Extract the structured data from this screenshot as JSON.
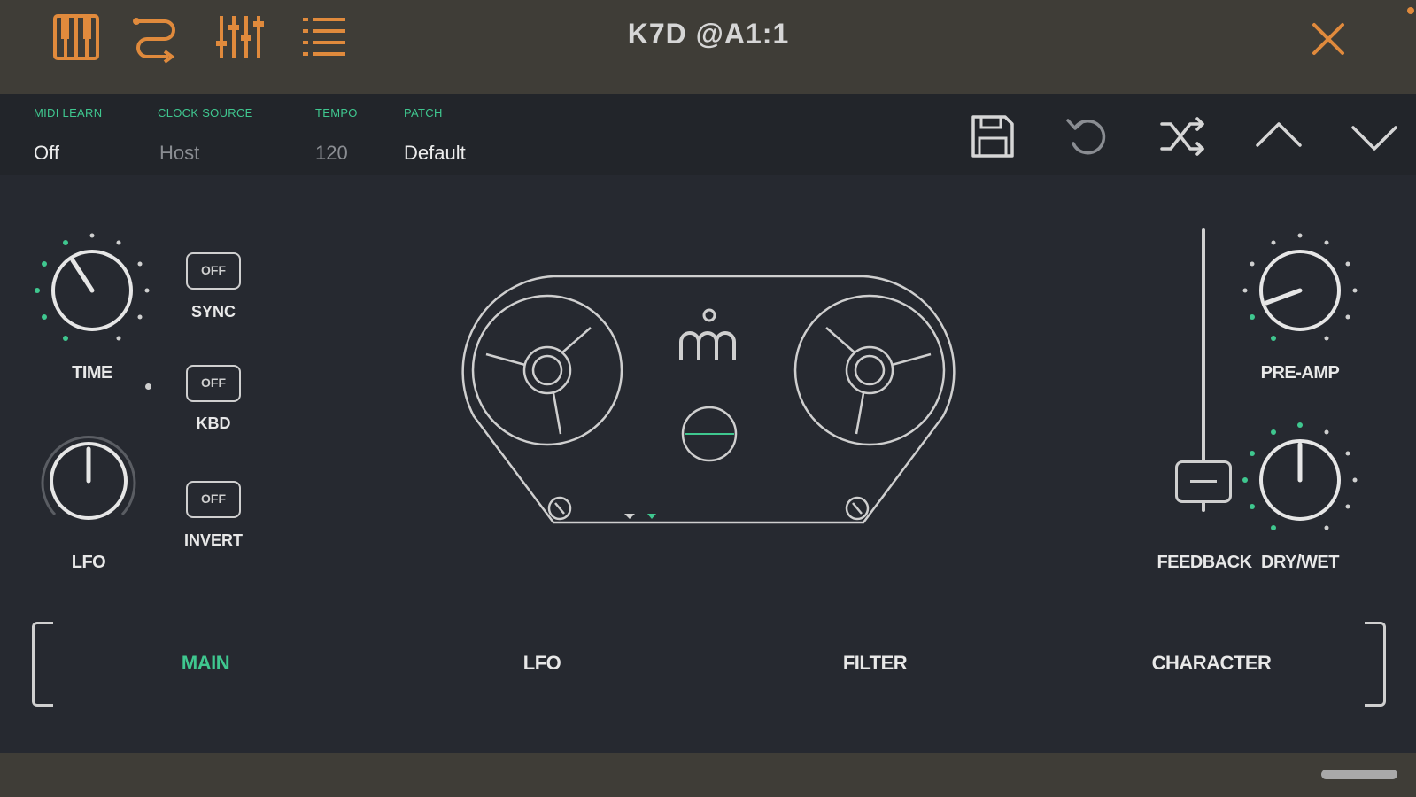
{
  "window": {
    "title": "K7D @A1:1",
    "accent": "#e08a3c",
    "green": "#3fc78f",
    "toolbar_icons": [
      "piano-keys-icon",
      "routing-icon",
      "mixer-faders-icon",
      "menu-list-icon"
    ],
    "close_icon": "close-icon"
  },
  "info_bar": {
    "midi_learn": {
      "label": "MIDI LEARN",
      "value": "Off"
    },
    "clock_source": {
      "label": "CLOCK SOURCE",
      "value": "Host"
    },
    "tempo": {
      "label": "TEMPO",
      "value": "120"
    },
    "patch": {
      "label": "PATCH",
      "value": "Default"
    },
    "actions": [
      "save-icon",
      "undo-icon",
      "shuffle-icon",
      "chevron-up-icon",
      "chevron-down-icon"
    ]
  },
  "controls": {
    "time": {
      "label": "TIME"
    },
    "lfo": {
      "label": "LFO"
    },
    "sync": {
      "label": "SYNC",
      "state": "OFF"
    },
    "kbd": {
      "label": "KBD",
      "state": "OFF"
    },
    "invert": {
      "label": "INVERT",
      "state": "OFF"
    },
    "pre_amp": {
      "label": "PRE-AMP"
    },
    "feedback": {
      "label": "FEEDBACK"
    },
    "dry_wet": {
      "label": "DRY/WET"
    }
  },
  "tabs": [
    {
      "label": "MAIN",
      "active": true
    },
    {
      "label": "LFO",
      "active": false
    },
    {
      "label": "FILTER",
      "active": false
    },
    {
      "label": "CHARACTER",
      "active": false
    }
  ]
}
